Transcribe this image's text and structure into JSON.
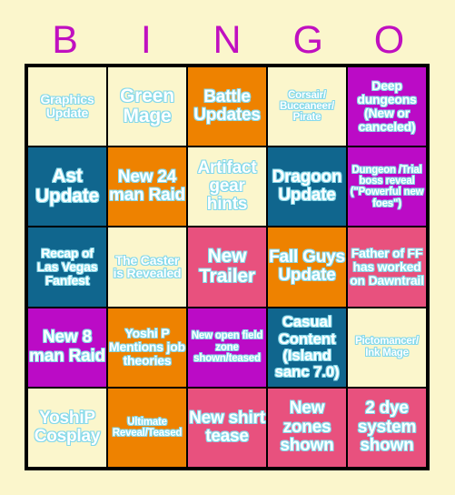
{
  "card": {
    "title": "BINGO",
    "background_color": "#fbf6cc",
    "text_fill_color": "#ffffff",
    "text_outline_color": "#86d9ea",
    "header_color": "#c010c0",
    "border_color": "#000000"
  },
  "header": {
    "letters": [
      "B",
      "I",
      "N",
      "G",
      "O"
    ]
  },
  "palette": {
    "cream": "#fbf6cc",
    "orange": "#ee8200",
    "magenta": "#bb0bc6",
    "teal": "#10668e",
    "pink": "#e8517e"
  },
  "grid": {
    "columns": 5,
    "rows": 5,
    "cells": [
      [
        {
          "label": "Graphics Update",
          "color": "#fbf6cc",
          "color_name": "cream",
          "size": "sm"
        },
        {
          "label": "Green Mage",
          "color": "#fbf6cc",
          "color_name": "cream",
          "size": "xl"
        },
        {
          "label": "Battle Updates",
          "color": "#ee8200",
          "color_name": "orange",
          "size": "lg"
        },
        {
          "label": "Corsair/ Buccaneer/ Pirate",
          "color": "#fbf6cc",
          "color_name": "cream",
          "size": "xs"
        },
        {
          "label": "Deep dungeons (New or canceled)",
          "color": "#bb0bc6",
          "color_name": "magenta",
          "size": "sm"
        }
      ],
      [
        {
          "label": "Ast Update",
          "color": "#10668e",
          "color_name": "teal",
          "size": "xl"
        },
        {
          "label": "New 24 man Raid",
          "color": "#ee8200",
          "color_name": "orange",
          "size": "lg"
        },
        {
          "label": "Artifact gear hints",
          "color": "#fbf6cc",
          "color_name": "cream",
          "size": "lg"
        },
        {
          "label": "Dragoon Update",
          "color": "#10668e",
          "color_name": "teal",
          "size": "lg"
        },
        {
          "label": "Dungeon /Trial boss reveal (\"Powerful new foes\")",
          "color": "#bb0bc6",
          "color_name": "magenta",
          "size": "xs"
        }
      ],
      [
        {
          "label": "Recap of Las Vegas Fanfest",
          "color": "#10668e",
          "color_name": "teal",
          "size": "sm"
        },
        {
          "label": "The Caster is Revealed",
          "color": "#fbf6cc",
          "color_name": "cream",
          "size": "sm"
        },
        {
          "label": "New Trailer",
          "color": "#e8517e",
          "color_name": "pink",
          "size": "xl"
        },
        {
          "label": "Fall Guys Update",
          "color": "#ee8200",
          "color_name": "orange",
          "size": "lg"
        },
        {
          "label": "Father of FF has worked on Dawntrail",
          "color": "#e8517e",
          "color_name": "pink",
          "size": "sm"
        }
      ],
      [
        {
          "label": "New 8 man Raid",
          "color": "#bb0bc6",
          "color_name": "magenta",
          "size": "lg"
        },
        {
          "label": "Yoshi P Mentions job theories",
          "color": "#ee8200",
          "color_name": "orange",
          "size": "sm"
        },
        {
          "label": "New open field zone shown/teased",
          "color": "#bb0bc6",
          "color_name": "magenta",
          "size": "xs"
        },
        {
          "label": "Casual Content (Island sanc 7.0)",
          "color": "#10668e",
          "color_name": "teal",
          "size": "md"
        },
        {
          "label": "Pictomancer/ Ink Mage",
          "color": "#fbf6cc",
          "color_name": "cream",
          "size": "xs"
        }
      ],
      [
        {
          "label": "YoshiP Cosplay",
          "color": "#fbf6cc",
          "color_name": "cream",
          "size": "lg"
        },
        {
          "label": "Ultimate Reveal/Teased",
          "color": "#ee8200",
          "color_name": "orange",
          "size": "xs"
        },
        {
          "label": "New shirt tease",
          "color": "#e8517e",
          "color_name": "pink",
          "size": "lg"
        },
        {
          "label": "New zones shown",
          "color": "#e8517e",
          "color_name": "pink",
          "size": "lg"
        },
        {
          "label": "2 dye system shown",
          "color": "#e8517e",
          "color_name": "pink",
          "size": "lg"
        }
      ]
    ]
  }
}
